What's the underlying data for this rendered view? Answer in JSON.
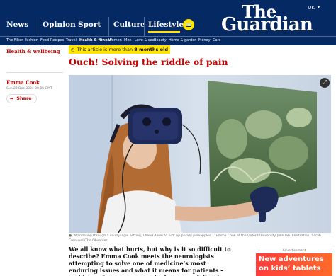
{
  "masthead": {
    "nav": [
      "News",
      "Opinion",
      "Sport",
      "Culture",
      "Lifestyle"
    ],
    "active_index": 4,
    "region": "UK",
    "logo_line1": "The",
    "logo_line2": "Guardian",
    "brand_color": "#052962",
    "accent_color": "#ffe500",
    "menu_icon": "hamburger-icon"
  },
  "subnav": {
    "items": [
      "The Filter",
      "Fashion",
      "Food",
      "Recipes",
      "Travel",
      "Health & fitness",
      "Women",
      "Men",
      "Love & sex",
      "Beauty",
      "Home & garden",
      "Money",
      "Cars"
    ],
    "active": "Health & fitness"
  },
  "article": {
    "section": "Health & wellbeing",
    "notice_prefix": "This article is more than",
    "notice_age": "8 months old",
    "headline": "Ouch! Solving the riddle of pain",
    "author": "Emma Cook",
    "dateline": "Sun 22 Dec 2024 00.05 GMT",
    "share_label": "Share",
    "caption": "‘Wandering through a vivid jungle setting, I bend down to pick up prickly pineapples…’ Emma Cook at the Oxford University pain lab. Illustration: Sarah Cresswell/The Observer",
    "standfirst": "We all know what hurts, but why is it so difficult to describe? Emma Cook meets the neurologists attempting to solve one of medicine’s most enduring issues and what it means for patients – and hears from a woman who has never felt pain",
    "section_color": "#c70000"
  },
  "advert": {
    "label": "Advertisement",
    "line1": "New adventures",
    "line2": "on kids’ tablets"
  }
}
